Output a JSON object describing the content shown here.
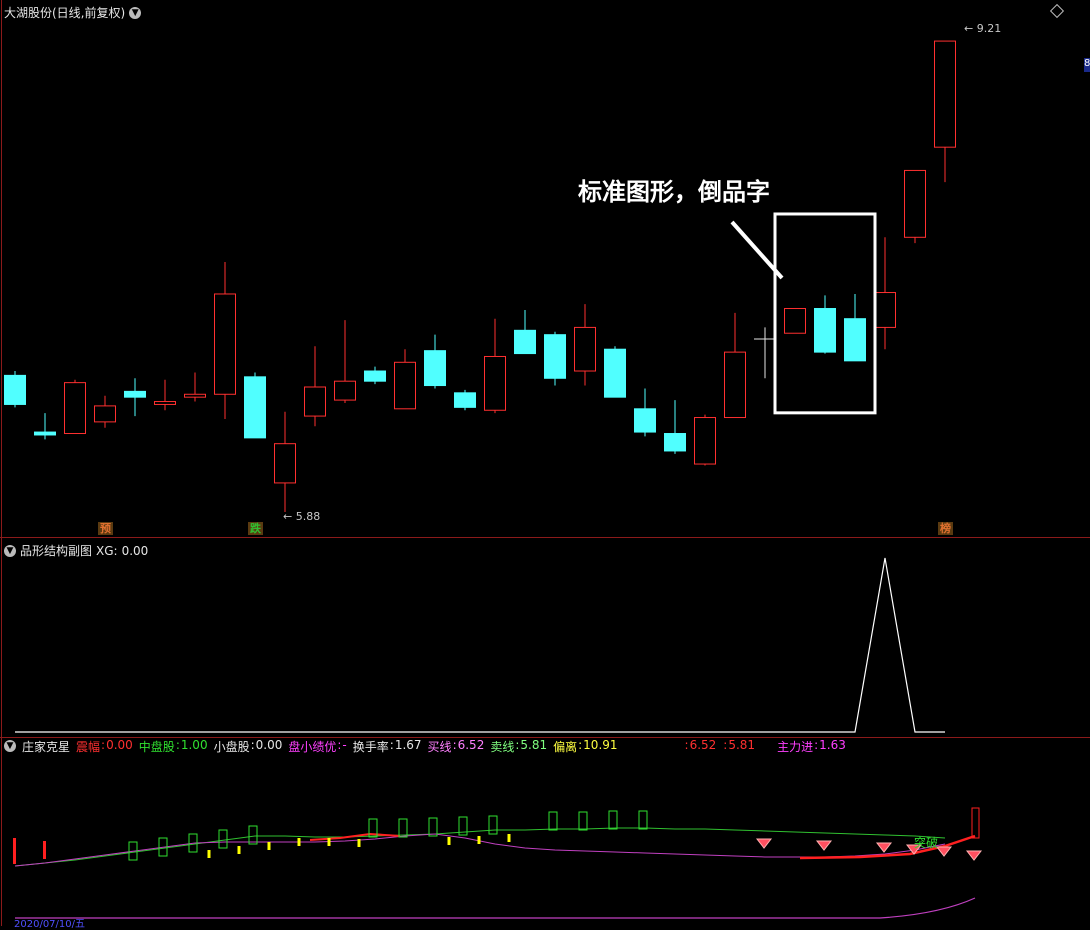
{
  "main": {
    "title": "大湖股份(日线,前复权)",
    "high_label": "9.21",
    "low_label": "5.88",
    "edge_label": "8",
    "callout": "标准图形，倒品字",
    "tags": [
      {
        "text": "预",
        "color": "#e07030"
      },
      {
        "text": "跌",
        "color": "#30c030"
      },
      {
        "text": "榜",
        "color": "#e07030"
      }
    ]
  },
  "chart_data": {
    "type": "candlestick",
    "title": "大湖股份(日线,前复权)",
    "ylim": [
      5.88,
      9.21
    ],
    "candles": [
      {
        "open": 6.82,
        "close": 6.62,
        "high": 6.85,
        "low": 6.6
      },
      {
        "open": 6.43,
        "close": 6.41,
        "high": 6.56,
        "low": 6.38
      },
      {
        "open": 6.42,
        "close": 6.77,
        "high": 6.79,
        "low": 6.42
      },
      {
        "open": 6.5,
        "close": 6.61,
        "high": 6.68,
        "low": 6.46
      },
      {
        "open": 6.71,
        "close": 6.67,
        "high": 6.8,
        "low": 6.54
      },
      {
        "open": 6.62,
        "close": 6.64,
        "high": 6.79,
        "low": 6.58
      },
      {
        "open": 6.67,
        "close": 6.69,
        "high": 6.84,
        "low": 6.64
      },
      {
        "open": 6.69,
        "close": 7.38,
        "high": 7.6,
        "low": 6.52
      },
      {
        "open": 6.81,
        "close": 6.39,
        "high": 6.84,
        "low": 6.39
      },
      {
        "open": 6.08,
        "close": 6.35,
        "high": 6.57,
        "low": 5.88
      },
      {
        "open": 6.54,
        "close": 6.74,
        "high": 7.02,
        "low": 6.47
      },
      {
        "open": 6.65,
        "close": 6.78,
        "high": 7.2,
        "low": 6.63
      },
      {
        "open": 6.85,
        "close": 6.78,
        "high": 6.88,
        "low": 6.76
      },
      {
        "open": 6.59,
        "close": 6.91,
        "high": 7.0,
        "low": 6.59
      },
      {
        "open": 6.99,
        "close": 6.75,
        "high": 7.1,
        "low": 6.73
      },
      {
        "open": 6.7,
        "close": 6.6,
        "high": 6.72,
        "low": 6.58
      },
      {
        "open": 6.58,
        "close": 6.95,
        "high": 7.21,
        "low": 6.56
      },
      {
        "open": 7.13,
        "close": 6.97,
        "high": 7.27,
        "low": 6.97
      },
      {
        "open": 7.1,
        "close": 6.8,
        "high": 7.12,
        "low": 6.75
      },
      {
        "open": 6.85,
        "close": 7.15,
        "high": 7.31,
        "low": 6.75
      },
      {
        "open": 7.0,
        "close": 6.67,
        "high": 7.02,
        "low": 6.67
      },
      {
        "open": 6.59,
        "close": 6.43,
        "high": 6.73,
        "low": 6.4
      },
      {
        "open": 6.42,
        "close": 6.3,
        "high": 6.65,
        "low": 6.28
      },
      {
        "open": 6.21,
        "close": 6.53,
        "high": 6.55,
        "low": 6.2
      },
      {
        "open": 6.53,
        "close": 6.98,
        "high": 7.25,
        "low": 6.53
      },
      {
        "open": 7.07,
        "close": 7.07,
        "high": 7.15,
        "low": 6.8
      },
      {
        "open": 7.11,
        "close": 7.28,
        "high": 7.28,
        "low": 7.11
      },
      {
        "open": 7.28,
        "close": 6.98,
        "high": 7.37,
        "low": 6.97
      },
      {
        "open": 7.21,
        "close": 6.92,
        "high": 7.38,
        "low": 6.92
      },
      {
        "open": 7.15,
        "close": 7.39,
        "high": 7.77,
        "low": 7.0
      },
      {
        "open": 7.77,
        "close": 8.23,
        "high": 8.23,
        "low": 7.73
      },
      {
        "open": 8.39,
        "close": 9.12,
        "high": 9.12,
        "low": 8.15
      }
    ],
    "tag_positions": [
      3,
      8,
      31
    ],
    "highlight_range": [
      26,
      29
    ]
  },
  "sub": {
    "title": "品形结构副图",
    "xg_label": "XG:",
    "xg_value": "0.00",
    "signal": [
      0,
      0,
      0,
      0,
      0,
      0,
      0,
      0,
      0,
      0,
      0,
      0,
      0,
      0,
      0,
      0,
      0,
      0,
      0,
      0,
      0,
      0,
      0,
      0,
      0,
      0,
      0,
      0,
      0,
      1,
      0,
      0
    ]
  },
  "indicator": {
    "title": "庄家克星",
    "legend": [
      {
        "label": "震幅",
        "sep": ":",
        "value": "0.00",
        "color": "#ff3030"
      },
      {
        "label": "中盘股",
        "sep": ":",
        "value": "1.00",
        "color": "#30e030"
      },
      {
        "label": "小盘股",
        "sep": ":",
        "value": "0.00",
        "color": "#e6e6e6"
      },
      {
        "label": "盘小绩优",
        "sep": ":",
        "value": "-",
        "color": "#ff40ff"
      },
      {
        "label": "换手率",
        "sep": ":",
        "value": "1.67",
        "color": "#e6e6e6"
      },
      {
        "label": "买线",
        "sep": ":",
        "value": "6.52",
        "color": "#ff80ff"
      },
      {
        "label": "卖线",
        "sep": ":",
        "value": "5.81",
        "color": "#80ff80"
      },
      {
        "label": "偏离",
        "sep": ":",
        "value": "10.91",
        "color": "#ffff40"
      },
      {
        "label": "",
        "sep": ":",
        "value": "6.52",
        "color": "#ff3030"
      },
      {
        "label": "",
        "sep": ":",
        "value": "5.81",
        "color": "#ff3030"
      },
      {
        "label": "主力进",
        "sep": ":",
        "value": "1.63",
        "color": "#ff40ff"
      }
    ],
    "breakout_label": "突破",
    "bottom_date": "2020/07/10/五",
    "colors": {
      "up": "#ff3030",
      "down": "#50ffff",
      "green": "#30e030",
      "yellow": "#ffff00",
      "purple": "#c040c0",
      "red_line": "#ff2020"
    }
  }
}
